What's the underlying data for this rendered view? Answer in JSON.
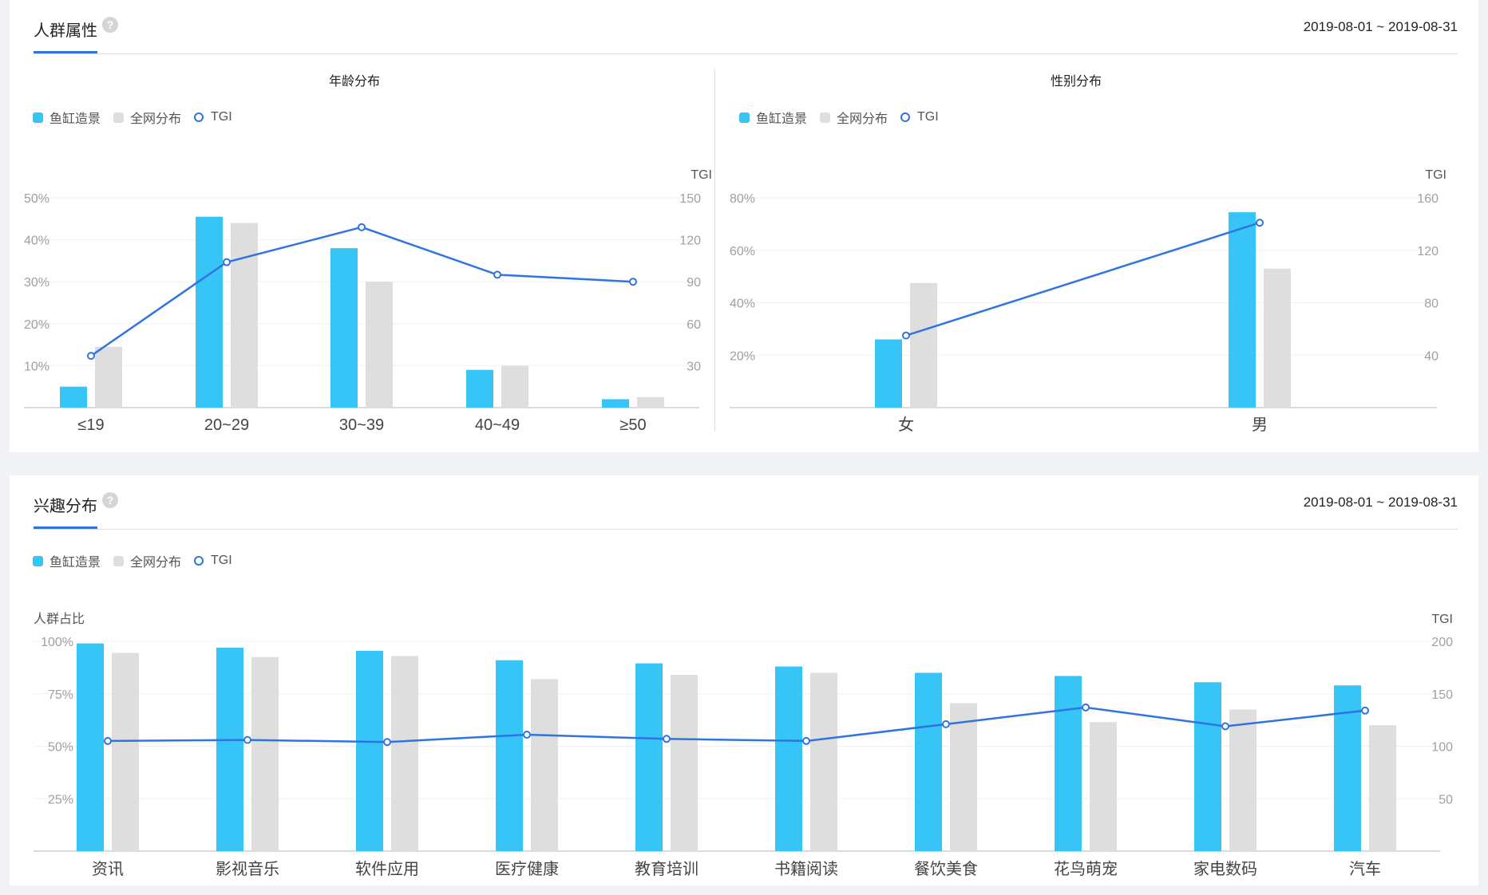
{
  "colors": {
    "primary": "#36c5f6",
    "secondary": "#dedede",
    "tgi": "#2f74e0"
  },
  "demographics": {
    "tab_label": "人群属性",
    "help_icon": "?",
    "date_range": "2019-08-01 ~ 2019-08-31"
  },
  "interests_section": {
    "tab_label": "兴趣分布",
    "help_icon": "?",
    "date_range": "2019-08-01 ~ 2019-08-31"
  },
  "legend": {
    "primary": "鱼缸造景",
    "secondary": "全网分布",
    "tgi": "TGI"
  },
  "chart_data": [
    {
      "type": "bar",
      "title": "年龄分布",
      "categories": [
        "≤19",
        "20~29",
        "30~39",
        "40~49",
        "≥50"
      ],
      "series": [
        {
          "name": "鱼缸造景",
          "values": [
            5,
            45.5,
            38,
            9,
            2
          ]
        },
        {
          "name": "全网分布",
          "values": [
            14.5,
            44,
            30,
            10,
            2.5
          ]
        },
        {
          "name": "TGI",
          "type": "line",
          "axis": "right",
          "values": [
            37,
            104,
            129,
            95,
            90
          ]
        }
      ],
      "ylim": [
        0,
        50
      ],
      "y_ticks": [
        "10%",
        "20%",
        "30%",
        "40%",
        "50%"
      ],
      "y2label": "TGI",
      "y2lim": [
        0,
        150
      ],
      "y2_ticks": [
        "30",
        "60",
        "90",
        "120",
        "150"
      ]
    },
    {
      "type": "bar",
      "title": "性别分布",
      "categories": [
        "女",
        "男"
      ],
      "series": [
        {
          "name": "鱼缸造景",
          "values": [
            26,
            74.5
          ]
        },
        {
          "name": "全网分布",
          "values": [
            47.5,
            53
          ]
        },
        {
          "name": "TGI",
          "type": "line",
          "axis": "right",
          "values": [
            55,
            141
          ]
        }
      ],
      "ylim": [
        0,
        80
      ],
      "y_ticks": [
        "20%",
        "40%",
        "60%",
        "80%"
      ],
      "y2label": "TGI",
      "y2lim": [
        0,
        160
      ],
      "y2_ticks": [
        "40",
        "80",
        "120",
        "160"
      ]
    },
    {
      "type": "bar",
      "categories": [
        "资讯",
        "影视音乐",
        "软件应用",
        "医疗健康",
        "教育培训",
        "书籍阅读",
        "餐饮美食",
        "花鸟萌宠",
        "家电数码",
        "汽车"
      ],
      "series": [
        {
          "name": "鱼缸造景",
          "values": [
            99,
            97,
            95.5,
            91,
            89.5,
            88,
            85,
            83.5,
            80.5,
            79
          ]
        },
        {
          "name": "全网分布",
          "values": [
            94.5,
            92.5,
            93,
            82,
            84,
            85,
            70.5,
            61.5,
            67.5,
            60
          ]
        },
        {
          "name": "TGI",
          "type": "line",
          "axis": "right",
          "values": [
            105,
            106,
            104,
            111,
            107,
            105,
            121,
            137,
            119,
            134
          ]
        }
      ],
      "ylabel": "人群占比",
      "ylim": [
        0,
        100
      ],
      "y_ticks": [
        "25%",
        "50%",
        "75%",
        "100%"
      ],
      "y2label": "TGI",
      "y2lim": [
        0,
        200
      ],
      "y2_ticks": [
        "50",
        "100",
        "150",
        "200"
      ]
    }
  ]
}
